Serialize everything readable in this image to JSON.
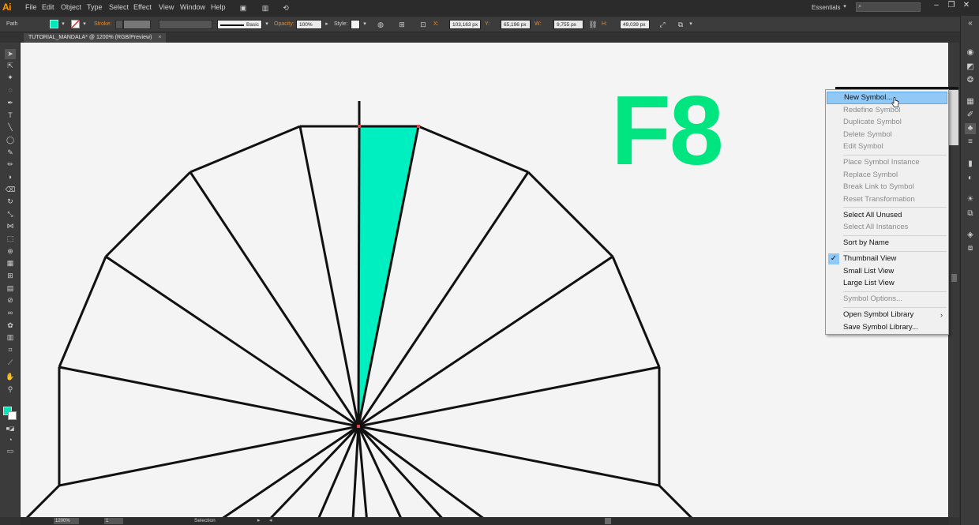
{
  "app": {
    "logo": "Ai",
    "menu": [
      "File",
      "Edit",
      "Object",
      "Type",
      "Select",
      "Effect",
      "View",
      "Window",
      "Help"
    ],
    "workspace": "Essentials",
    "window_controls": [
      "–",
      "❐",
      "✕"
    ]
  },
  "control_bar": {
    "object_type": "Path",
    "stroke_label": "Stroke:",
    "brush_style": "Basic",
    "opacity_label": "Opacity:",
    "opacity_value": "100%",
    "style_label": "Style:",
    "x_label": "X:",
    "x_value": "103,163 px",
    "y_label": "Y:",
    "y_value": "65,196 px",
    "w_label": "W:",
    "w_value": "9,755 px",
    "h_label": "H:",
    "h_value": "49,039 px"
  },
  "document": {
    "tab_title": "TUTORIAL_MANDALA* @ 1200% (RGB/Preview)",
    "tab_close": "×"
  },
  "canvas": {
    "overlay_text": "F8",
    "fill_color": "#00efc0",
    "overlay_color": "#00e57f"
  },
  "status_bar": {
    "zoom": "1200%",
    "page": "1",
    "tool": "Selection"
  },
  "context_menu": {
    "groups": [
      [
        {
          "label": "New Symbol...",
          "enabled": true,
          "highlighted": true
        },
        {
          "label": "Redefine Symbol",
          "enabled": false
        },
        {
          "label": "Duplicate Symbol",
          "enabled": false
        },
        {
          "label": "Delete Symbol",
          "enabled": false
        },
        {
          "label": "Edit Symbol",
          "enabled": false
        }
      ],
      [
        {
          "label": "Place Symbol Instance",
          "enabled": false
        },
        {
          "label": "Replace Symbol",
          "enabled": false
        },
        {
          "label": "Break Link to Symbol",
          "enabled": false
        },
        {
          "label": "Reset Transformation",
          "enabled": false
        }
      ],
      [
        {
          "label": "Select All Unused",
          "enabled": true
        },
        {
          "label": "Select All Instances",
          "enabled": false
        }
      ],
      [
        {
          "label": "Sort by Name",
          "enabled": true
        }
      ],
      [
        {
          "label": "Thumbnail View",
          "enabled": true,
          "checked": true
        },
        {
          "label": "Small List View",
          "enabled": true
        },
        {
          "label": "Large List View",
          "enabled": true
        }
      ],
      [
        {
          "label": "Symbol Options...",
          "enabled": false
        }
      ],
      [
        {
          "label": "Open Symbol Library",
          "enabled": true,
          "submenu": true
        },
        {
          "label": "Save Symbol Library...",
          "enabled": true
        }
      ]
    ]
  }
}
